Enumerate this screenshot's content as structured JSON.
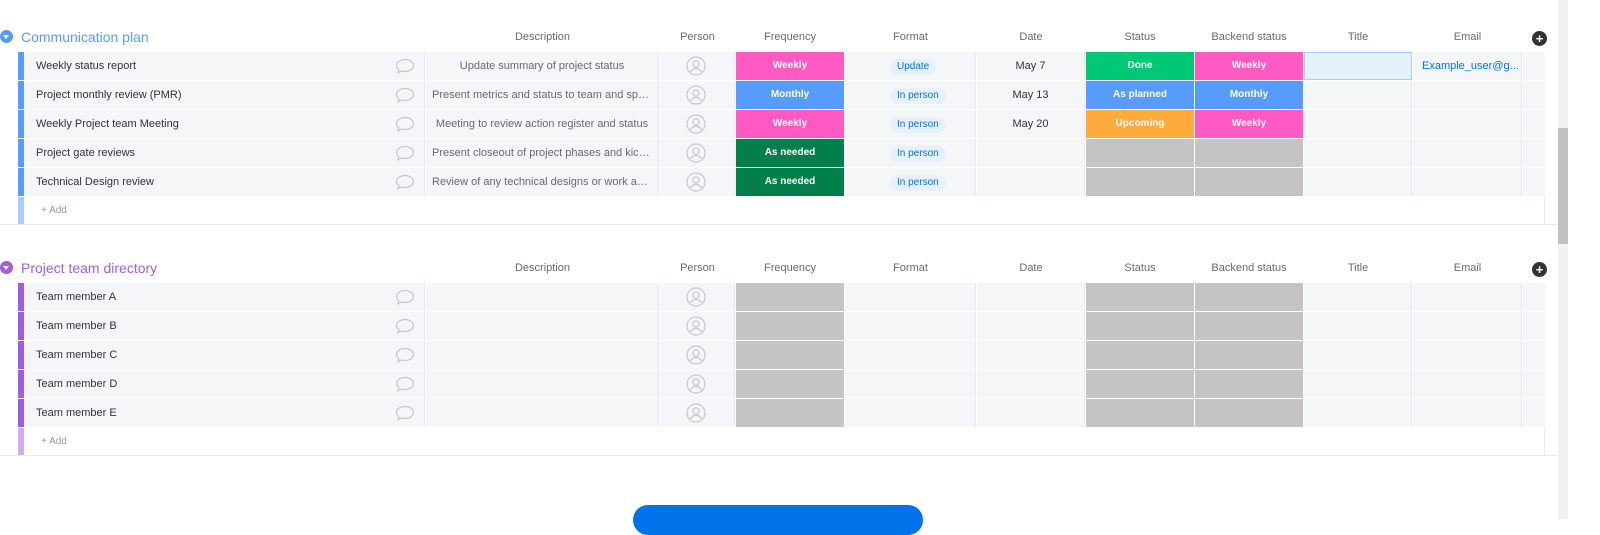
{
  "columns": {
    "description": "Description",
    "person": "Person",
    "frequency": "Frequency",
    "format": "Format",
    "date": "Date",
    "status": "Status",
    "backend_status": "Backend status",
    "title": "Title",
    "email": "Email"
  },
  "colors": {
    "group1": "#579bfc",
    "group2": "#a25ddc",
    "weekly": "#ff5ac4",
    "monthly": "#579bfc",
    "as_needed": "#037f4c",
    "done": "#00c875",
    "as_planned": "#579bfc",
    "upcoming": "#fdab3d",
    "empty": "#c4c4c4"
  },
  "groups": [
    {
      "title": "Communication plan",
      "add_label": "+ Add",
      "rows": [
        {
          "name": "Weekly status report",
          "description": "Update summary of project status",
          "frequency": "Weekly",
          "format": "Update",
          "date": "May 7",
          "status": "Done",
          "backend_status": "Weekly",
          "email": "Example_user@g..."
        },
        {
          "name": "Project monthly review (PMR)",
          "description": "Present metrics and status to team and sponsor",
          "frequency": "Monthly",
          "format": "In person",
          "date": "May 13",
          "status": "As planned",
          "backend_status": "Monthly",
          "email": ""
        },
        {
          "name": "Weekly Project team Meeting",
          "description": "Meeting to review action register and status",
          "frequency": "Weekly",
          "format": "In person",
          "date": "May 20",
          "status": "Upcoming",
          "backend_status": "Weekly",
          "email": ""
        },
        {
          "name": "Project gate reviews",
          "description": "Present closeout of project phases and kickoff...",
          "frequency": "As needed",
          "format": "In person",
          "date": "",
          "status": "",
          "backend_status": "",
          "email": ""
        },
        {
          "name": "Technical Design review",
          "description": "Review of any technical designs or work assoc...",
          "frequency": "As needed",
          "format": "In person",
          "date": "",
          "status": "",
          "backend_status": "",
          "email": ""
        }
      ]
    },
    {
      "title": "Project team directory",
      "add_label": "+ Add",
      "rows": [
        {
          "name": "Team member A"
        },
        {
          "name": "Team member B"
        },
        {
          "name": "Team member C"
        },
        {
          "name": "Team member D"
        },
        {
          "name": "Team member E"
        }
      ]
    }
  ]
}
